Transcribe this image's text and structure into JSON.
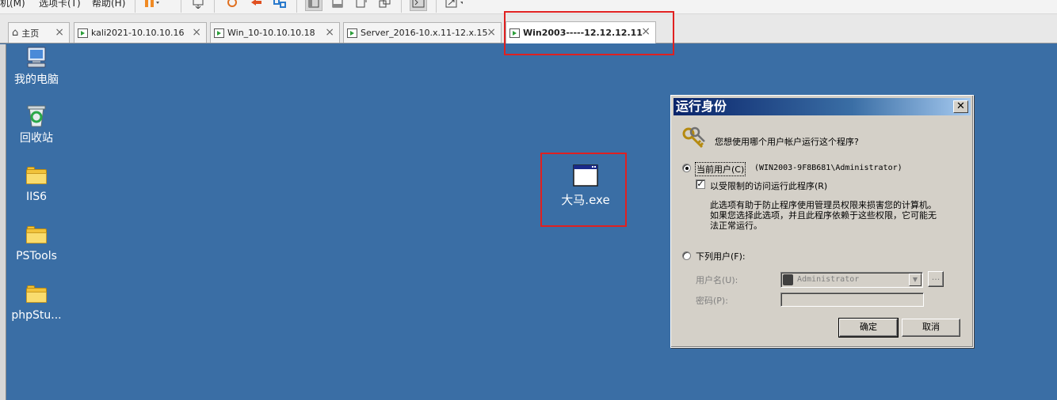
{
  "menubar": {
    "items": [
      "机(M)",
      "选项卡(T)",
      "帮助(H)"
    ]
  },
  "tabs": [
    {
      "label": "主页",
      "active": false
    },
    {
      "label": "kali2021-10.10.10.16",
      "active": false
    },
    {
      "label": "Win_10-10.10.10.18",
      "active": false
    },
    {
      "label": "Server_2016-10.x.11-12.x.15",
      "active": false
    },
    {
      "label": "Win2003-----12.12.12.11",
      "active": true
    }
  ],
  "desktop": {
    "icons": [
      {
        "label": "我的电脑",
        "icon": "my-computer-icon"
      },
      {
        "label": "回收站",
        "icon": "recycle-bin-icon"
      },
      {
        "label": "IIS6",
        "icon": "folder-icon"
      },
      {
        "label": "PSTools",
        "icon": "folder-icon"
      },
      {
        "label": "phpStu...",
        "icon": "folder-icon"
      }
    ],
    "file": {
      "label": "大马.exe",
      "icon": "exe-window-icon"
    }
  },
  "dialog": {
    "title": "运行身份",
    "question": "您想使用哪个用户帐户运行这个程序?",
    "current_user_label": "当前用户(C)",
    "current_user_value": "(WIN2003-9F8B681\\Administrator)",
    "current_user_selected": true,
    "restrict_label": "以受限制的访问运行此程序(R)",
    "restrict_checked": true,
    "note_lines": [
      "此选项有助于防止程序使用管理员权限来损害您的计算机。",
      "如果您选择此选项，并且此程序依赖于这些权限，它可能无",
      "法正常运行。"
    ],
    "following_user_label": "下列用户(F):",
    "following_user_selected": false,
    "username_label": "用户名(U):",
    "username_value": "Administrator",
    "password_label": "密码(P):",
    "password_value": "",
    "browse_label": "...",
    "ok_label": "确定",
    "cancel_label": "取消"
  },
  "colors": {
    "desktop_bg": "#3a6ea5",
    "highlight": "#e02020",
    "dialog_bg": "#d4d0c8",
    "title_bar": "#0a246a"
  }
}
